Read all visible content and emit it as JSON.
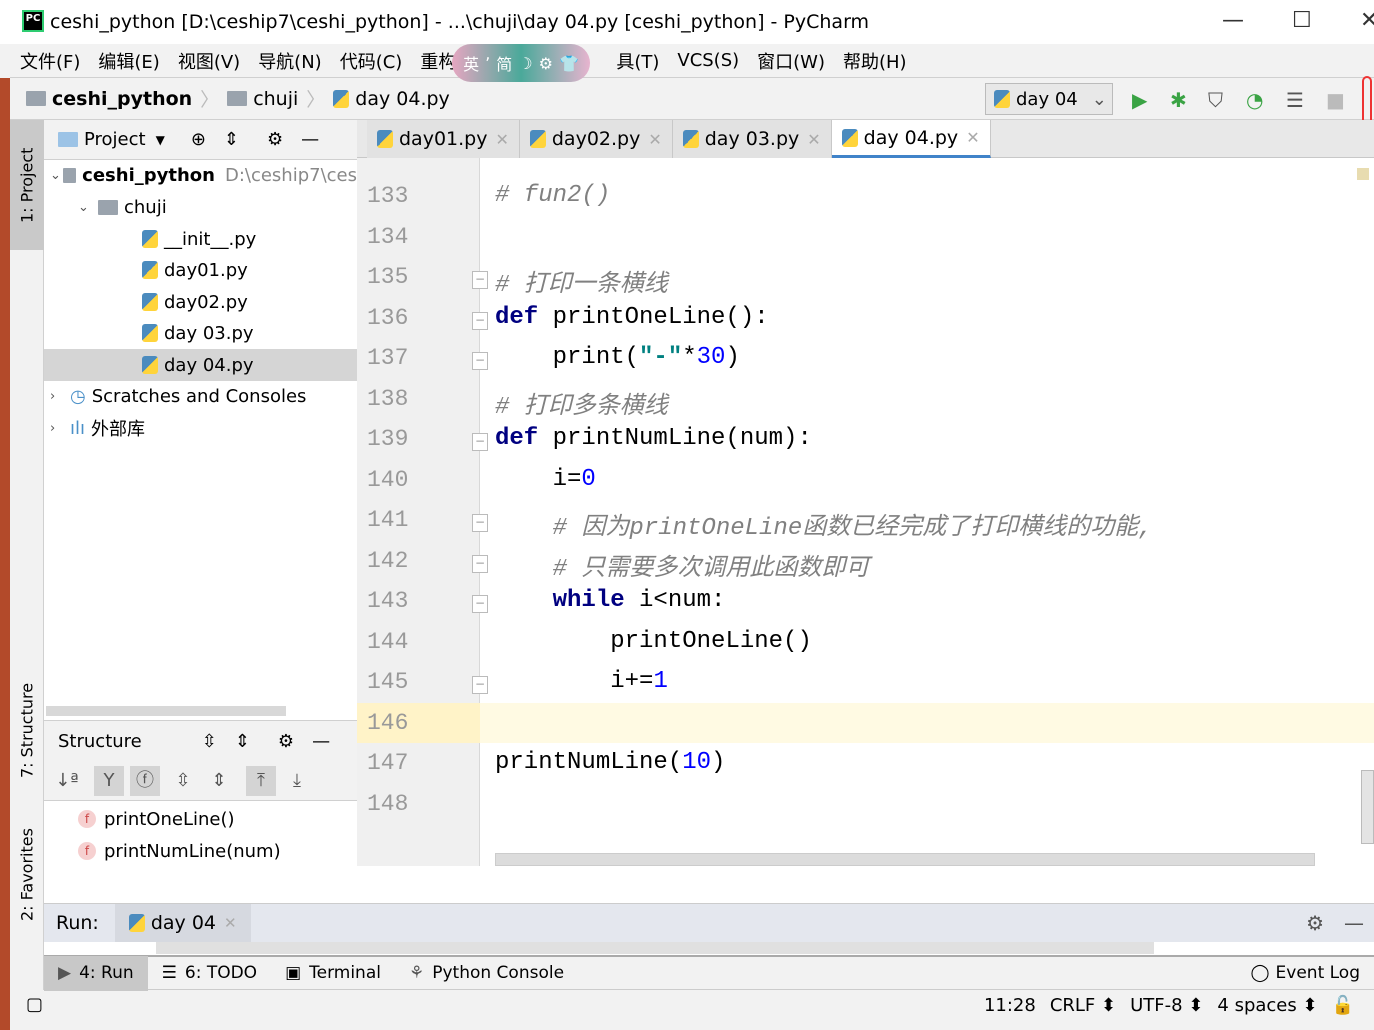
{
  "window": {
    "title": "ceshi_python [D:\\ceship7\\ceshi_python] - ...\\chuji\\day 04.py [ceshi_python] - PyCharm",
    "app_icon": "PC"
  },
  "menu": [
    "文件(F)",
    "编辑(E)",
    "视图(V)",
    "导航(N)",
    "代码(C)",
    "重构",
    "具(T)",
    "VCS(S)",
    "窗口(W)",
    "帮助(H)"
  ],
  "ime": [
    "英",
    "ʼ",
    "简",
    "☽",
    "⚙",
    "👕"
  ],
  "breadcrumb": [
    "ceshi_python",
    "chuji",
    "day 04.py"
  ],
  "run_config": "day 04",
  "project": {
    "header": "Project",
    "root": "ceshi_python",
    "root_path": "D:\\ceship7\\ces",
    "folder": "chuji",
    "files": [
      "__init__.py",
      "day01.py",
      "day02.py",
      "day 03.py",
      "day 04.py"
    ],
    "selected": "day 04.py",
    "scratches": "Scratches and Consoles",
    "libs": "外部库"
  },
  "structure": {
    "header": "Structure",
    "items": [
      "printOneLine()",
      "printNumLine(num)"
    ],
    "badge": "f"
  },
  "tool_windows": {
    "project": "1: Project",
    "structure": "7: Structure",
    "favorites": "2: Favorites"
  },
  "tabs": [
    "day01.py",
    "day02.py",
    "day 03.py",
    "day 04.py"
  ],
  "active_tab": "day 04.py",
  "code": {
    "current_line": 146,
    "lines": [
      {
        "n": "133",
        "t": [
          [
            "c",
            "# fun2()"
          ]
        ]
      },
      {
        "n": "134",
        "t": []
      },
      {
        "n": "135",
        "t": [
          [
            "c",
            "# 打印一条横线"
          ]
        ]
      },
      {
        "n": "136",
        "t": [
          [
            "k",
            "def "
          ],
          [
            "p",
            "printOneLine():"
          ]
        ]
      },
      {
        "n": "137",
        "t": [
          [
            "p",
            "    print("
          ],
          [
            "s",
            "\"-\""
          ],
          [
            "p",
            "*"
          ],
          [
            "n",
            "30"
          ],
          [
            "p",
            ")"
          ]
        ]
      },
      {
        "n": "138",
        "t": [
          [
            "c",
            "# 打印多条横线"
          ]
        ]
      },
      {
        "n": "139",
        "t": [
          [
            "k",
            "def "
          ],
          [
            "p",
            "printNumLine(num):"
          ]
        ]
      },
      {
        "n": "140",
        "t": [
          [
            "p",
            "    i="
          ],
          [
            "n",
            "0"
          ]
        ]
      },
      {
        "n": "141",
        "t": [
          [
            "c",
            "    # 因为printOneLine函数已经完成了打印横线的功能,"
          ]
        ]
      },
      {
        "n": "142",
        "t": [
          [
            "c",
            "    # 只需要多次调用此函数即可"
          ]
        ]
      },
      {
        "n": "143",
        "t": [
          [
            "k",
            "    while "
          ],
          [
            "p",
            "i<num:"
          ]
        ]
      },
      {
        "n": "144",
        "t": [
          [
            "p",
            "        printOneLine()"
          ]
        ]
      },
      {
        "n": "145",
        "t": [
          [
            "p",
            "        i+="
          ],
          [
            "n",
            "1"
          ]
        ]
      },
      {
        "n": "146",
        "t": []
      },
      {
        "n": "147",
        "t": [
          [
            "p",
            "printNumLine("
          ],
          [
            "n",
            "10"
          ],
          [
            "p",
            ")"
          ]
        ]
      },
      {
        "n": "148",
        "t": []
      }
    ]
  },
  "run": {
    "label": "Run:",
    "tab": "day 04"
  },
  "bottom_tabs": [
    "4: Run",
    "6: TODO",
    "Terminal",
    "Python Console"
  ],
  "event_log": "Event Log",
  "status": {
    "position": "11:28",
    "line_sep": "CRLF",
    "encoding": "UTF-8",
    "indent": "4 spaces"
  }
}
